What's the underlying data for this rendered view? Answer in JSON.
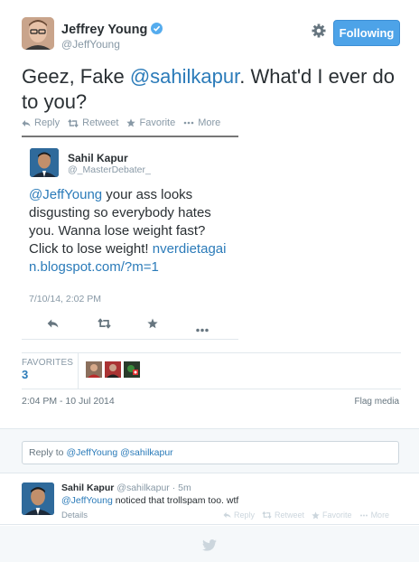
{
  "author": {
    "name": "Jeffrey Young",
    "handle": "@JeffYoung"
  },
  "follow_button": "Following",
  "tweet": {
    "text_before": "Geez, Fake ",
    "mention": "@sahilkapur",
    "text_after": ". What'd I ever do to you?"
  },
  "actions": {
    "reply": "Reply",
    "retweet": "Retweet",
    "favorite": "Favorite",
    "more": "More"
  },
  "quoted": {
    "name": "Sahil Kapur",
    "handle": "@_MasterDebater_",
    "mention": "@JeffYoung",
    "text": " your ass looks disgusting so everybody hates you. Wanna lose weight fast? Click to lose weight! ",
    "link": "nverdietagain.blogspot.com/?m=1",
    "date": "7/10/14, 2:02 PM"
  },
  "stats": {
    "favorites_label": "FAVORITES",
    "favorites_count": "3"
  },
  "timestamp": "2:04 PM - 10 Jul 2014",
  "flag_media": "Flag media",
  "reply_box": {
    "prefix": "Reply to ",
    "mentions": "@JeffYoung @sahilkapur"
  },
  "reply": {
    "name": "Sahil Kapur",
    "handle": "@sahilkapur",
    "time": "5m",
    "mention": "@JeffYoung",
    "text": " noticed that trollspam too. wtf",
    "details": "Details"
  },
  "colors": {
    "link": "#2b7bb9",
    "follow_button": "#4da3e8",
    "verified": "#55acee"
  }
}
